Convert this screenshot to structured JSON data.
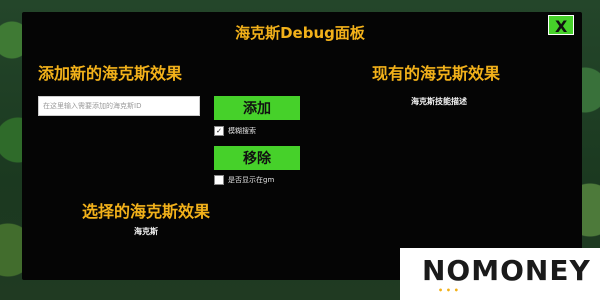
{
  "panel": {
    "title": "海克斯Debug面板",
    "close_label": "X"
  },
  "add_section": {
    "heading": "添加新的海克斯效果",
    "input_placeholder": "在这里输入需要添加的海克斯ID",
    "add_button": "添加",
    "fuzzy_search_label": "模糊搜索",
    "fuzzy_search_checked": true,
    "remove_button": "移除",
    "show_in_gm_label": "是否显示在gm",
    "show_in_gm_checked": false
  },
  "selected_section": {
    "heading": "选择的海克斯效果",
    "value": "海克斯"
  },
  "existing_section": {
    "heading": "现有的海克斯效果",
    "description": "海克斯技能描述"
  },
  "watermark": {
    "logo_text": "NOMONEY"
  },
  "colors": {
    "accent": "#f2b11a",
    "button_green": "#46d12a",
    "panel_bg": "#050505"
  }
}
